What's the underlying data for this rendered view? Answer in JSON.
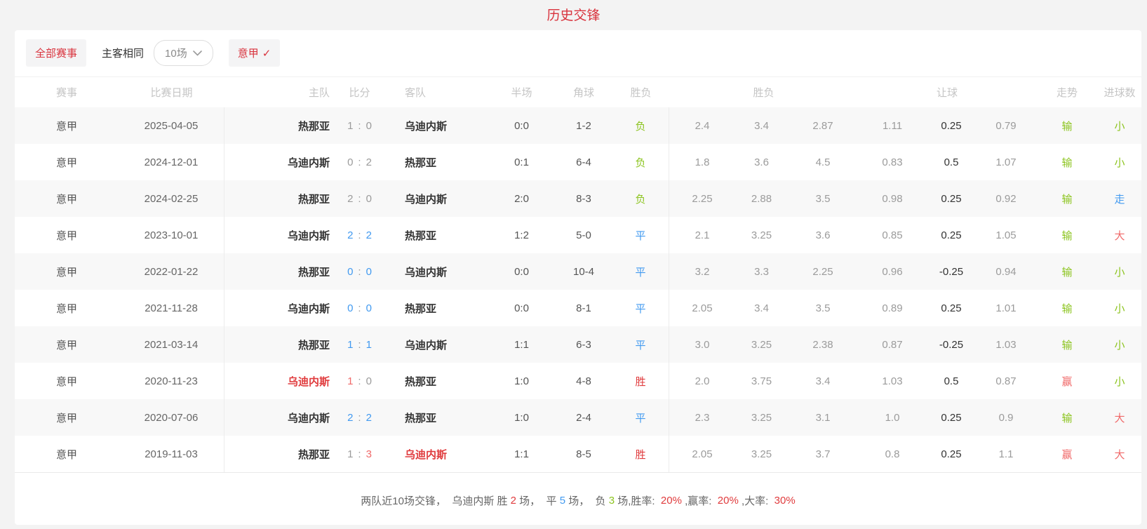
{
  "title": "历史交锋",
  "colors": {
    "accent_red": "#d9343e",
    "strong_red": "#e03b3d",
    "soft_red": "#f06a6a",
    "blue": "#429af0",
    "green": "#8cc41f",
    "gray": "#9b9b9b",
    "dark": "#333333"
  },
  "filters": {
    "all_label": "全部赛事",
    "same_venue_label": "主客相同",
    "count_value": "10场",
    "league_label": "意甲",
    "check_mark": "✓"
  },
  "table": {
    "headers": [
      "赛事",
      "比赛日期",
      "主队",
      "比分",
      "客队",
      "半场",
      "角球",
      "胜负",
      "胜负",
      "让球",
      "走势",
      "进球数"
    ],
    "rows": [
      {
        "league": "意甲",
        "date": "2025-04-05",
        "home": "热那亚",
        "home_color": "dark",
        "score_home": "1",
        "score_home_color": "gray",
        "score_away": "0",
        "score_away_color": "gray",
        "away": "乌迪内斯",
        "away_color": "dark",
        "half": "0:0",
        "corner": "1-2",
        "result": "负",
        "result_color": "green",
        "odds": [
          "2.4",
          "3.4",
          "2.87"
        ],
        "handicap": [
          "1.11",
          "0.25",
          "0.79"
        ],
        "trend": "输",
        "trend_color": "green",
        "goals": "小",
        "goals_color": "green"
      },
      {
        "league": "意甲",
        "date": "2024-12-01",
        "home": "乌迪内斯",
        "home_color": "dark",
        "score_home": "0",
        "score_home_color": "gray",
        "score_away": "2",
        "score_away_color": "gray",
        "away": "热那亚",
        "away_color": "dark",
        "half": "0:1",
        "corner": "6-4",
        "result": "负",
        "result_color": "green",
        "odds": [
          "1.8",
          "3.6",
          "4.5"
        ],
        "handicap": [
          "0.83",
          "0.5",
          "1.07"
        ],
        "trend": "输",
        "trend_color": "green",
        "goals": "小",
        "goals_color": "green"
      },
      {
        "league": "意甲",
        "date": "2024-02-25",
        "home": "热那亚",
        "home_color": "dark",
        "score_home": "2",
        "score_home_color": "gray",
        "score_away": "0",
        "score_away_color": "gray",
        "away": "乌迪内斯",
        "away_color": "dark",
        "half": "2:0",
        "corner": "8-3",
        "result": "负",
        "result_color": "green",
        "odds": [
          "2.25",
          "2.88",
          "3.5"
        ],
        "handicap": [
          "0.98",
          "0.25",
          "0.92"
        ],
        "trend": "输",
        "trend_color": "green",
        "goals": "走",
        "goals_color": "blue"
      },
      {
        "league": "意甲",
        "date": "2023-10-01",
        "home": "乌迪内斯",
        "home_color": "dark",
        "score_home": "2",
        "score_home_color": "blue",
        "score_away": "2",
        "score_away_color": "blue",
        "away": "热那亚",
        "away_color": "dark",
        "half": "1:2",
        "corner": "5-0",
        "result": "平",
        "result_color": "blue",
        "odds": [
          "2.1",
          "3.25",
          "3.6"
        ],
        "handicap": [
          "0.85",
          "0.25",
          "1.05"
        ],
        "trend": "输",
        "trend_color": "green",
        "goals": "大",
        "goals_color": "redsoft"
      },
      {
        "league": "意甲",
        "date": "2022-01-22",
        "home": "热那亚",
        "home_color": "dark",
        "score_home": "0",
        "score_home_color": "blue",
        "score_away": "0",
        "score_away_color": "blue",
        "away": "乌迪内斯",
        "away_color": "dark",
        "half": "0:0",
        "corner": "10-4",
        "result": "平",
        "result_color": "blue",
        "odds": [
          "3.2",
          "3.3",
          "2.25"
        ],
        "handicap": [
          "0.96",
          "-0.25",
          "0.94"
        ],
        "trend": "输",
        "trend_color": "green",
        "goals": "小",
        "goals_color": "green"
      },
      {
        "league": "意甲",
        "date": "2021-11-28",
        "home": "乌迪内斯",
        "home_color": "dark",
        "score_home": "0",
        "score_home_color": "blue",
        "score_away": "0",
        "score_away_color": "blue",
        "away": "热那亚",
        "away_color": "dark",
        "half": "0:0",
        "corner": "8-1",
        "result": "平",
        "result_color": "blue",
        "odds": [
          "2.05",
          "3.4",
          "3.5"
        ],
        "handicap": [
          "0.89",
          "0.25",
          "1.01"
        ],
        "trend": "输",
        "trend_color": "green",
        "goals": "小",
        "goals_color": "green"
      },
      {
        "league": "意甲",
        "date": "2021-03-14",
        "home": "热那亚",
        "home_color": "dark",
        "score_home": "1",
        "score_home_color": "blue",
        "score_away": "1",
        "score_away_color": "blue",
        "away": "乌迪内斯",
        "away_color": "dark",
        "half": "1:1",
        "corner": "6-3",
        "result": "平",
        "result_color": "blue",
        "odds": [
          "3.0",
          "3.25",
          "2.38"
        ],
        "handicap": [
          "0.87",
          "-0.25",
          "1.03"
        ],
        "trend": "输",
        "trend_color": "green",
        "goals": "小",
        "goals_color": "green"
      },
      {
        "league": "意甲",
        "date": "2020-11-23",
        "home": "乌迪内斯",
        "home_color": "red",
        "score_home": "1",
        "score_home_color": "redsoft",
        "score_away": "0",
        "score_away_color": "gray",
        "away": "热那亚",
        "away_color": "dark",
        "half": "1:0",
        "corner": "4-8",
        "result": "胜",
        "result_color": "red",
        "odds": [
          "2.0",
          "3.75",
          "3.4"
        ],
        "handicap": [
          "1.03",
          "0.5",
          "0.87"
        ],
        "trend": "赢",
        "trend_color": "redsoft",
        "goals": "小",
        "goals_color": "green"
      },
      {
        "league": "意甲",
        "date": "2020-07-06",
        "home": "乌迪内斯",
        "home_color": "dark",
        "score_home": "2",
        "score_home_color": "blue",
        "score_away": "2",
        "score_away_color": "blue",
        "away": "热那亚",
        "away_color": "dark",
        "half": "1:0",
        "corner": "2-4",
        "result": "平",
        "result_color": "blue",
        "odds": [
          "2.3",
          "3.25",
          "3.1"
        ],
        "handicap": [
          "1.0",
          "0.25",
          "0.9"
        ],
        "trend": "输",
        "trend_color": "green",
        "goals": "大",
        "goals_color": "redsoft"
      },
      {
        "league": "意甲",
        "date": "2019-11-03",
        "home": "热那亚",
        "home_color": "dark",
        "score_home": "1",
        "score_home_color": "gray",
        "score_away": "3",
        "score_away_color": "redsoft",
        "away": "乌迪内斯",
        "away_color": "red",
        "half": "1:1",
        "corner": "8-5",
        "result": "胜",
        "result_color": "red",
        "odds": [
          "2.05",
          "3.25",
          "3.7"
        ],
        "handicap": [
          "0.8",
          "0.25",
          "1.1"
        ],
        "trend": "赢",
        "trend_color": "redsoft",
        "goals": "大",
        "goals_color": "redsoft"
      }
    ]
  },
  "summary": {
    "segments": [
      {
        "text": "两队近10场交锋，  乌迪内斯 胜 ",
        "color": ""
      },
      {
        "text": "2",
        "color": "red"
      },
      {
        "text": " 场，  平 ",
        "color": ""
      },
      {
        "text": "5",
        "color": "blue"
      },
      {
        "text": " 场，  负 ",
        "color": ""
      },
      {
        "text": "3",
        "color": "green"
      },
      {
        "text": " 场,胜率:  ",
        "color": ""
      },
      {
        "text": "20%",
        "color": "red"
      },
      {
        "text": " ,赢率:  ",
        "color": ""
      },
      {
        "text": "20%",
        "color": "red"
      },
      {
        "text": " ,大率:  ",
        "color": ""
      },
      {
        "text": "30%",
        "color": "red"
      }
    ]
  }
}
